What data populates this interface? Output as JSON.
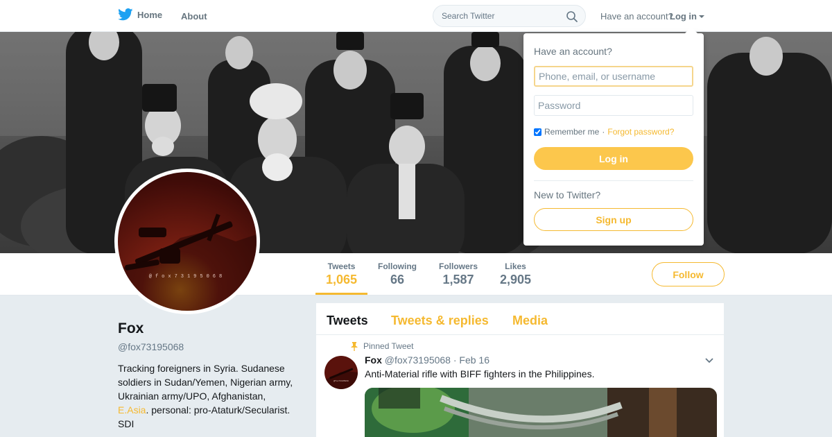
{
  "nav": {
    "home_label": "Home",
    "about_label": "About",
    "search_placeholder": "Search Twitter",
    "have_account": "Have an account?",
    "login_label": "Log in"
  },
  "login_dropdown": {
    "title": "Have an account?",
    "username_placeholder": "Phone, email, or username",
    "password_placeholder": "Password",
    "remember_label": "Remember me",
    "separator": "·",
    "forgot_label": "Forgot password?",
    "login_button": "Log in",
    "new_label": "New to Twitter?",
    "signup_button": "Sign up"
  },
  "profile": {
    "name": "Fox",
    "handle": "@fox73195068",
    "bio_before_link": "Tracking foreigners in Syria. Sudanese soldiers in Sudan/Yemen, Nigerian army, Ukrainian army/UPO, Afghanistan,",
    "bio_link": "E.Asia",
    "bio_after_link": ". personal: pro-Ataturk/Secularist. SDI",
    "avatar_text": "@fox73195068"
  },
  "stats": [
    {
      "label": "Tweets",
      "value": "1,065",
      "active": true
    },
    {
      "label": "Following",
      "value": "66"
    },
    {
      "label": "Followers",
      "value": "1,587"
    },
    {
      "label": "Likes",
      "value": "2,905"
    }
  ],
  "follow_label": "Follow",
  "tabs": [
    {
      "label": "Tweets",
      "active": true
    },
    {
      "label": "Tweets & replies"
    },
    {
      "label": "Media"
    }
  ],
  "tweet": {
    "pinned_label": "Pinned Tweet",
    "name": "Fox",
    "handle": "@fox73195068",
    "separator": "·",
    "date": "Feb 16",
    "text": "Anti-Material rifle with BIFF fighters in the Philippines."
  },
  "colors": {
    "accent": "#f5b930",
    "login_button": "#fcc74c",
    "twitter_blue": "#1da1f2",
    "avatar_bg": "#4a0f0a"
  }
}
